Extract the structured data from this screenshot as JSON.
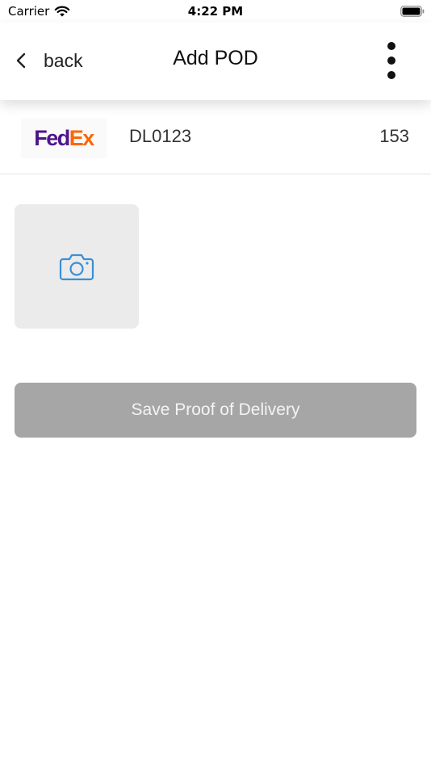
{
  "status_bar": {
    "carrier": "Carrier",
    "time": "4:22 PM",
    "wifi_icon": "wifi-icon",
    "battery_icon": "battery-icon"
  },
  "nav": {
    "back_icon": "chevron-left-icon",
    "back_label": "back",
    "title": "Add POD",
    "menu_icon": "more-vertical-icon"
  },
  "shipment": {
    "carrier_logo": {
      "part1": "Fed",
      "part2": "Ex",
      "colors": {
        "fed": "#4d148c",
        "ex": "#ff6600"
      }
    },
    "tracking_id": "DL0123",
    "quantity": "153"
  },
  "photo_upload": {
    "icon": "camera-icon",
    "icon_color": "#3b8fd6"
  },
  "save_button": {
    "label": "Save Proof of Delivery",
    "state": "disabled",
    "color": "#a6a6a6"
  }
}
